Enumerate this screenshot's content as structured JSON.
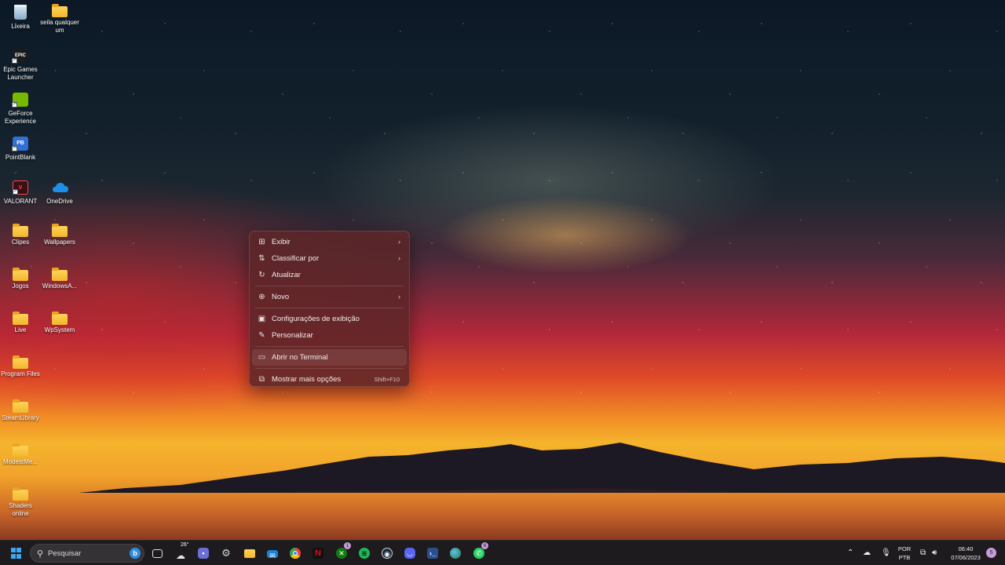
{
  "desktop": {
    "icons": [
      {
        "label": "Lixeira",
        "type": "recycle"
      },
      {
        "label": "seila qualquer um",
        "type": "folder"
      },
      {
        "label": "Epic Games Launcher",
        "type": "app",
        "glyph": "EPIC",
        "color": "#1b1b1b"
      },
      {
        "label": "GeForce Experience",
        "type": "app",
        "glyph": "",
        "color": "#76b900"
      },
      {
        "label": "PointBlank",
        "type": "app",
        "glyph": "PB",
        "color": "#2f6fd6"
      },
      {
        "label": "VALORANT",
        "type": "app",
        "glyph": "V",
        "color": "#ff4655"
      },
      {
        "label": "OneDrive",
        "type": "onedrive"
      },
      {
        "label": "Clipes",
        "type": "folder"
      },
      {
        "label": "Wallpapers",
        "type": "folder"
      },
      {
        "label": "Jogos",
        "type": "folder"
      },
      {
        "label": "WindowsA...",
        "type": "folder"
      },
      {
        "label": "Live",
        "type": "folder"
      },
      {
        "label": "WpSystem",
        "type": "folder"
      },
      {
        "label": "Program Files",
        "type": "folder"
      },
      {
        "label": "SteamLibrary",
        "type": "folder"
      },
      {
        "label": "ModestMe...",
        "type": "folder"
      },
      {
        "label": "Shaders online",
        "type": "folder"
      }
    ]
  },
  "context_menu": {
    "items": [
      {
        "label": "Exibir",
        "icon": "grid-view-icon",
        "submenu": true
      },
      {
        "label": "Classificar por",
        "icon": "sort-icon",
        "submenu": true
      },
      {
        "label": "Atualizar",
        "icon": "refresh-icon",
        "submenu": false
      },
      {
        "label": "Novo",
        "icon": "new-plus-icon",
        "submenu": true
      },
      {
        "label": "Configurações de exibição",
        "icon": "display-settings-icon",
        "submenu": false
      },
      {
        "label": "Personalizar",
        "icon": "brush-icon",
        "submenu": false
      },
      {
        "label": "Abrir no Terminal",
        "icon": "terminal-icon",
        "submenu": false,
        "hover": true
      },
      {
        "label": "Mostrar mais opções",
        "icon": "more-options-icon",
        "submenu": false,
        "shortcut": "Shift+F10"
      }
    ]
  },
  "taskbar": {
    "search_placeholder": "Pesquisar",
    "weather_temp": "26°",
    "badges": {
      "xbox": "1",
      "whatsapp": "6"
    },
    "tray": {
      "language_line1": "POR",
      "language_line2": "PTB",
      "time": "06:40",
      "date": "07/06/2023",
      "notification_count": "5"
    },
    "colors": {
      "accent": "#3fa7f2",
      "badge": "#c79bd8"
    }
  }
}
